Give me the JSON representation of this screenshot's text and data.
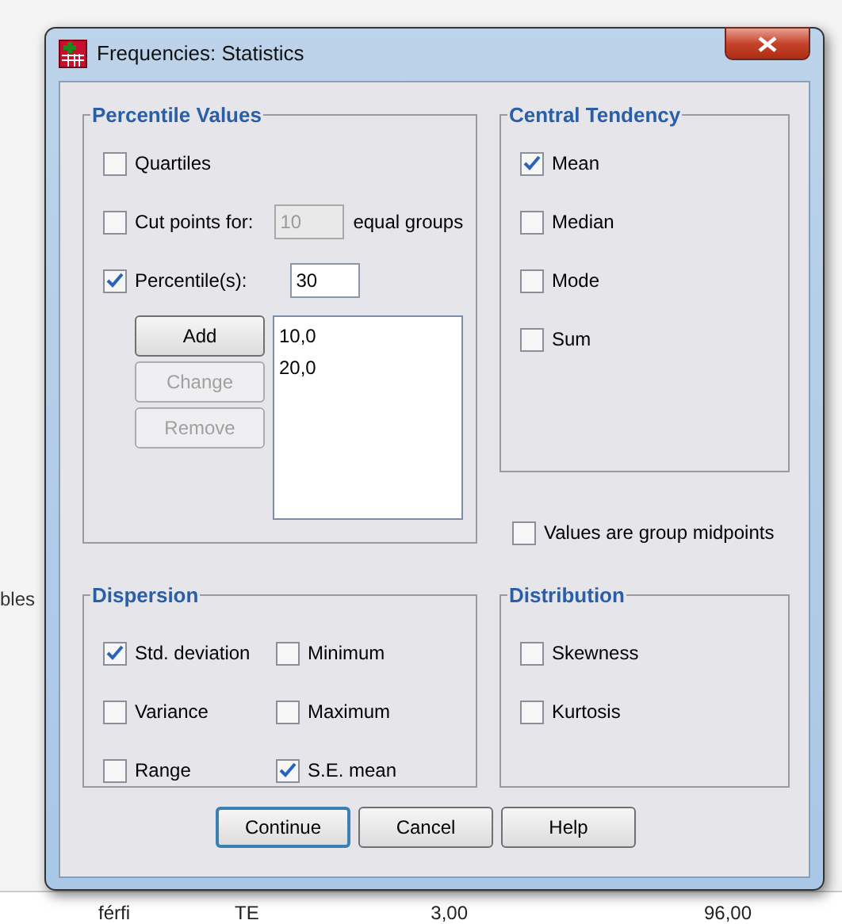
{
  "background": {
    "side_text": "bles",
    "row": [
      "férfi",
      "TE",
      "3,00",
      "96,00"
    ]
  },
  "window": {
    "title": "Frequencies: Statistics"
  },
  "percentile_values": {
    "title": "Percentile Values",
    "quartiles": {
      "label": "Quartiles",
      "checked": false
    },
    "cut_points": {
      "label": "Cut points for:",
      "checked": false,
      "value": "10",
      "disabled": true,
      "suffix": "equal groups"
    },
    "percentiles": {
      "label": "Percentile(s):",
      "checked": true,
      "value": "30"
    },
    "buttons": [
      {
        "label": "Add",
        "disabled": false
      },
      {
        "label": "Change",
        "disabled": true
      },
      {
        "label": "Remove",
        "disabled": true
      }
    ],
    "list": [
      "10,0",
      "20,0"
    ]
  },
  "central_tendency": {
    "title": "Central Tendency",
    "options": [
      {
        "label": "Mean",
        "checked": true
      },
      {
        "label": "Median",
        "checked": false
      },
      {
        "label": "Mode",
        "checked": false
      },
      {
        "label": "Sum",
        "checked": false
      }
    ]
  },
  "values_are_group_midpoints": {
    "label": "Values are group midpoints",
    "checked": false
  },
  "dispersion": {
    "title": "Dispersion",
    "options": [
      {
        "label": "Std. deviation",
        "checked": true
      },
      {
        "label": "Minimum",
        "checked": false
      },
      {
        "label": "Variance",
        "checked": false
      },
      {
        "label": "Maximum",
        "checked": false
      },
      {
        "label": "Range",
        "checked": false
      },
      {
        "label": "S.E. mean",
        "checked": true
      }
    ]
  },
  "distribution": {
    "title": "Distribution",
    "options": [
      {
        "label": "Skewness",
        "checked": false
      },
      {
        "label": "Kurtosis",
        "checked": false
      }
    ]
  },
  "buttons": [
    {
      "label": "Continue",
      "default": true
    },
    {
      "label": "Cancel",
      "default": false
    },
    {
      "label": "Help",
      "default": false
    }
  ]
}
